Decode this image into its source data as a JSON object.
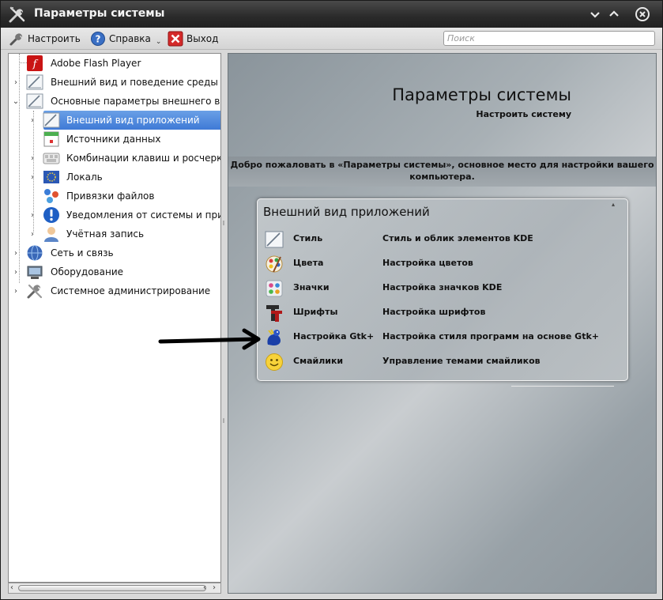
{
  "window": {
    "title": "Параметры системы"
  },
  "toolbar": {
    "configure_label": "Настроить",
    "help_label": "Справка",
    "exit_label": "Выход",
    "search_placeholder": "Поиск"
  },
  "tree": {
    "items": [
      {
        "label": "Adobe Flash Player",
        "icon": "flash-icon"
      },
      {
        "label": "Внешний вид и поведение среды раб",
        "icon": "appearance-icon"
      },
      {
        "label": "Основные параметры внешнего вида",
        "icon": "appearance-icon"
      },
      {
        "label": "Внешний вид приложений",
        "icon": "app-style-icon",
        "selected": true
      },
      {
        "label": "Источники данных",
        "icon": "calendar-icon"
      },
      {
        "label": "Комбинации клавиш и росчерки",
        "icon": "keyboard-icon"
      },
      {
        "label": "Локаль",
        "icon": "locale-icon"
      },
      {
        "label": "Привязки файлов",
        "icon": "file-assoc-icon"
      },
      {
        "label": "Уведомления от системы и прилож",
        "icon": "notification-icon"
      },
      {
        "label": "Учётная запись",
        "icon": "user-icon"
      },
      {
        "label": "Сеть и связь",
        "icon": "network-icon"
      },
      {
        "label": "Оборудование",
        "icon": "hardware-icon"
      },
      {
        "label": "Системное администрирование",
        "icon": "admin-icon"
      }
    ]
  },
  "content": {
    "title": "Параметры системы",
    "subtitle": "Настроить систему",
    "welcome_line1": "Добро пожаловать в «Параметры системы», основное место для настройки вашего",
    "welcome_line2": "компьютера."
  },
  "card": {
    "title": "Внешний вид приложений",
    "modules": [
      {
        "name": "Стиль",
        "desc": "Стиль и облик элементов KDE",
        "icon": "style-icon"
      },
      {
        "name": "Цвета",
        "desc": "Настройка цветов",
        "icon": "colors-icon"
      },
      {
        "name": "Значки",
        "desc": "Настройка значков KDE",
        "icon": "icons-icon"
      },
      {
        "name": "Шрифты",
        "desc": "Настройка шрифтов",
        "icon": "fonts-icon"
      },
      {
        "name": "Настройка Gtk+",
        "desc": "Настройка стиля программ на основе Gtk+",
        "icon": "gtk-icon"
      },
      {
        "name": "Смайлики",
        "desc": "Управление темами смайликов",
        "icon": "smiley-icon"
      }
    ]
  },
  "colors": {
    "selection": "#3f7ad6",
    "titlebar": "#2a2a2a"
  }
}
